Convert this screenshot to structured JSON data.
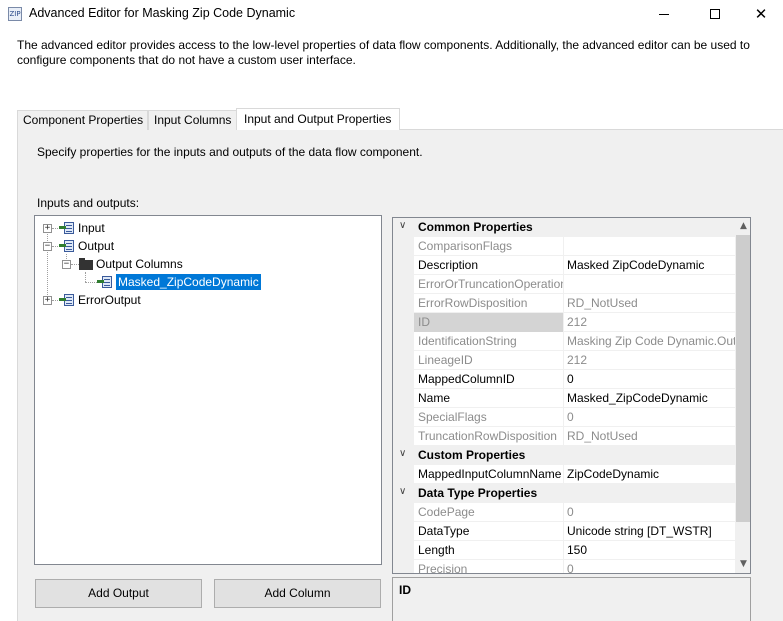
{
  "window": {
    "title": "Advanced Editor for Masking Zip Code Dynamic",
    "icon": "ssis-component-icon"
  },
  "description": "The advanced editor provides access to the low-level properties of data flow components. Additionally, the advanced editor can be used to configure components that do not have a custom user interface.",
  "tabs": [
    {
      "label": "Component Properties",
      "active": false
    },
    {
      "label": "Input Columns",
      "active": false
    },
    {
      "label": "Input and Output Properties",
      "active": true
    }
  ],
  "panel": {
    "instruction": "Specify properties for the inputs and outputs of the data flow component.",
    "io_label": "Inputs and outputs:"
  },
  "tree": {
    "input": "Input",
    "output": "Output",
    "output_columns": "Output Columns",
    "selected_column": "Masked_ZipCodeDynamic",
    "error_output": "ErrorOutput"
  },
  "buttons": {
    "add_output": "Add Output",
    "add_column": "Add Column"
  },
  "properties": {
    "common": {
      "header": "Common Properties",
      "rows": [
        {
          "name": "ComparisonFlags",
          "value": "",
          "readonly": true
        },
        {
          "name": "Description",
          "value": "Masked ZipCodeDynamic",
          "readonly": false
        },
        {
          "name": "ErrorOrTruncationOperation",
          "value": "",
          "readonly": true
        },
        {
          "name": "ErrorRowDisposition",
          "value": "RD_NotUsed",
          "readonly": true
        },
        {
          "name": "ID",
          "value": "212",
          "readonly": true
        },
        {
          "name": "IdentificationString",
          "value": "Masking Zip Code Dynamic.Output",
          "readonly": true
        },
        {
          "name": "LineageID",
          "value": "212",
          "readonly": true
        },
        {
          "name": "MappedColumnID",
          "value": "0",
          "readonly": false
        },
        {
          "name": "Name",
          "value": "Masked_ZipCodeDynamic",
          "readonly": false
        },
        {
          "name": "SpecialFlags",
          "value": "0",
          "readonly": true
        },
        {
          "name": "TruncationRowDisposition",
          "value": "RD_NotUsed",
          "readonly": true
        }
      ]
    },
    "custom": {
      "header": "Custom Properties",
      "rows": [
        {
          "name": "MappedInputColumnName",
          "value": "ZipCodeDynamic",
          "readonly": false
        }
      ]
    },
    "datatype": {
      "header": "Data Type Properties",
      "rows": [
        {
          "name": "CodePage",
          "value": "0",
          "readonly": true
        },
        {
          "name": "DataType",
          "value": "Unicode string [DT_WSTR]",
          "readonly": false
        },
        {
          "name": "Length",
          "value": "150",
          "readonly": false
        },
        {
          "name": "Precision",
          "value": "0",
          "readonly": true
        }
      ]
    }
  },
  "property_description": {
    "title": "ID"
  }
}
